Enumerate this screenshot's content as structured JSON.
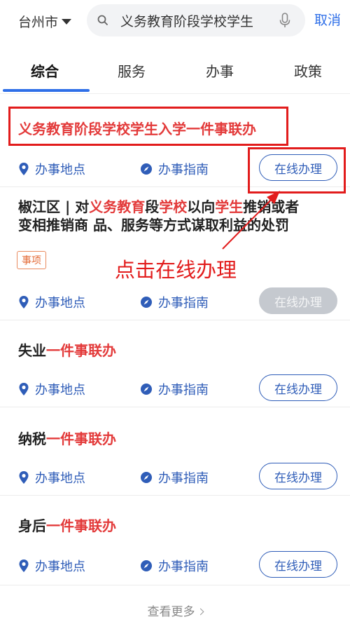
{
  "header": {
    "city": "台州市",
    "search_value": "义务教育阶段学校学生",
    "cancel_label": "取消"
  },
  "tabs": [
    {
      "label": "综合",
      "active": true
    },
    {
      "label": "服务",
      "active": false
    },
    {
      "label": "办事",
      "active": false
    },
    {
      "label": "政策",
      "active": false
    }
  ],
  "results": [
    {
      "title_highlight": "义务教育阶段学校学生入学一件事联办",
      "location_label": "办事地点",
      "guide_label": "办事指南",
      "online_label": "在线办理",
      "online_disabled": false
    },
    {
      "title_line1": {
        "p1": "椒江区 | 对",
        "h1": "义务教育",
        "p2": "段",
        "h2": "学校",
        "p3": "以向",
        "h3": "学生",
        "p4": "推销或者"
      },
      "title_line2": "变相推销商 品、服务等方式谋取利益的处罚",
      "tag": "事项",
      "location_label": "办事地点",
      "guide_label": "办事指南",
      "online_label": "在线办理",
      "online_disabled": true
    },
    {
      "title_plain": "失业",
      "title_highlight": "一件事联办",
      "location_label": "办事地点",
      "guide_label": "办事指南",
      "online_label": "在线办理",
      "online_disabled": false
    },
    {
      "title_plain": "纳税",
      "title_highlight": "一件事联办",
      "location_label": "办事地点",
      "guide_label": "办事指南",
      "online_label": "在线办理",
      "online_disabled": false
    },
    {
      "title_plain": "身后",
      "title_highlight": "一件事联办",
      "location_label": "办事地点",
      "guide_label": "办事指南",
      "online_label": "在线办理",
      "online_disabled": false
    }
  ],
  "annotation": {
    "text": "点击在线办理",
    "color": "#e21c1c"
  },
  "footer": {
    "more_label": "查看更多"
  },
  "colors": {
    "accent": "#2f6fe8",
    "link": "#2f5db8",
    "highlight": "#e33a3a"
  },
  "icons": [
    "search-icon",
    "microphone-icon",
    "location-pin-icon",
    "compass-icon",
    "chevron-right-icon",
    "caret-down-icon"
  ]
}
